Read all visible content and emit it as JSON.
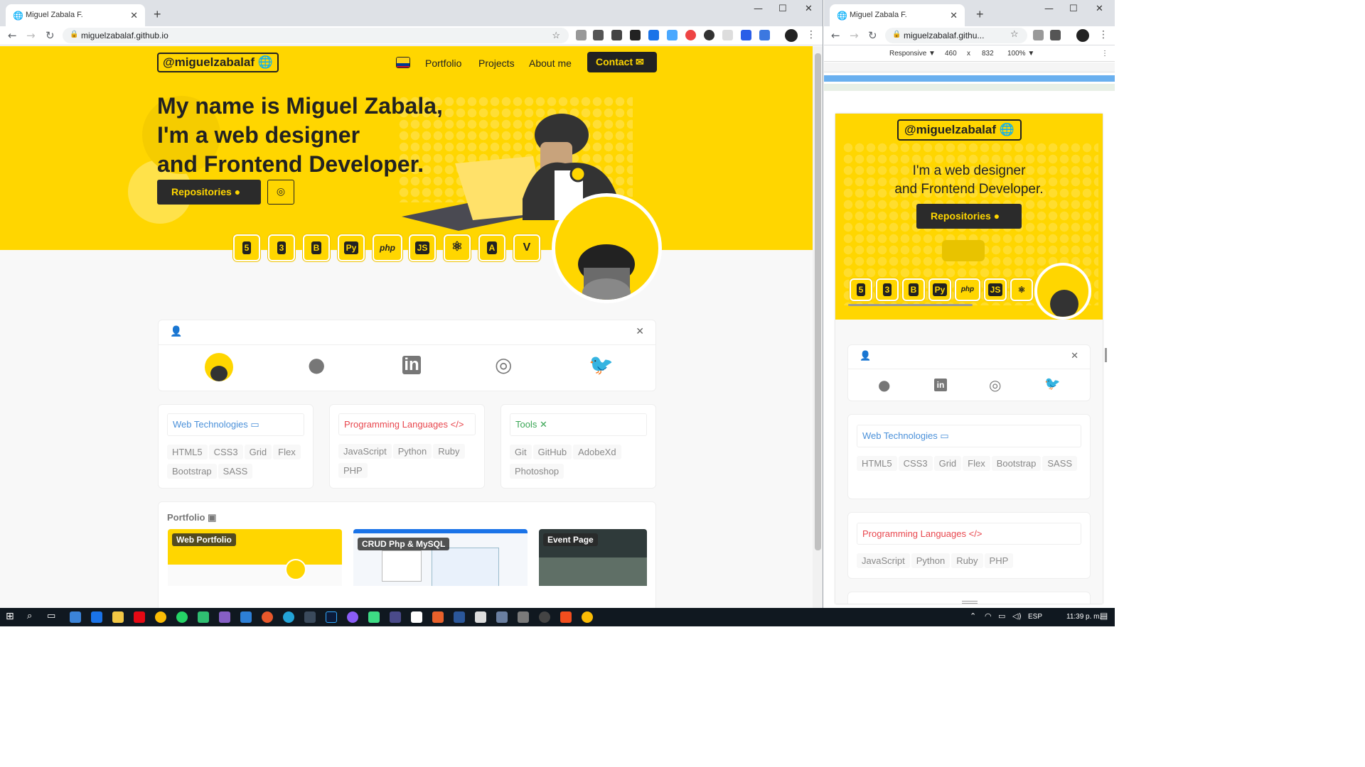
{
  "left_window": {
    "tab_title": "Miguel Zabala F.",
    "url": "miguelzabalaf.github.io",
    "controls": {
      "minimize": "—",
      "maximize": "☐",
      "close": "✕"
    }
  },
  "right_window": {
    "tab_title": "Miguel Zabala F.",
    "url": "miguelzabalaf.githu...",
    "devtools": {
      "mode": "Responsive ▼",
      "width": "460",
      "x": "x",
      "height": "832",
      "zoom": "100% ▼"
    }
  },
  "site": {
    "brand": "@miguelzabalaf",
    "nav": [
      "Portfolio",
      "Projects",
      "About me"
    ],
    "contact": "Contact",
    "headline": [
      "My name is Miguel Zabala,",
      "I'm a web designer",
      "and Frontend Developer."
    ],
    "repositories": "Repositories",
    "tech_icons": [
      "5",
      "3",
      "B",
      "Py",
      "php",
      "JS",
      "⚛",
      "A",
      "V"
    ],
    "sections": [
      {
        "title": "Web Technologies",
        "color": "#4a90d9",
        "items": [
          "HTML5",
          "CSS3",
          "Grid",
          "Flex",
          "Bootstrap",
          "SASS"
        ]
      },
      {
        "title": "Programming Languages",
        "color": "#e8474e",
        "items": [
          "JavaScript",
          "Python",
          "Ruby",
          "PHP"
        ]
      },
      {
        "title": "Tools",
        "color": "#3aa655",
        "items": [
          "Git",
          "GitHub",
          "AdobeXd",
          "Photoshop"
        ]
      }
    ],
    "portfolio_title": "Portfolio",
    "portfolio_items": [
      "Web Portfolio",
      "CRUD Php & MySQL",
      "Event Page"
    ],
    "mobile_headline": [
      "I'm a web designer",
      "and Frontend Developer."
    ]
  },
  "taskbar": {
    "lang": "ESP",
    "time": "11:39 p. m."
  }
}
